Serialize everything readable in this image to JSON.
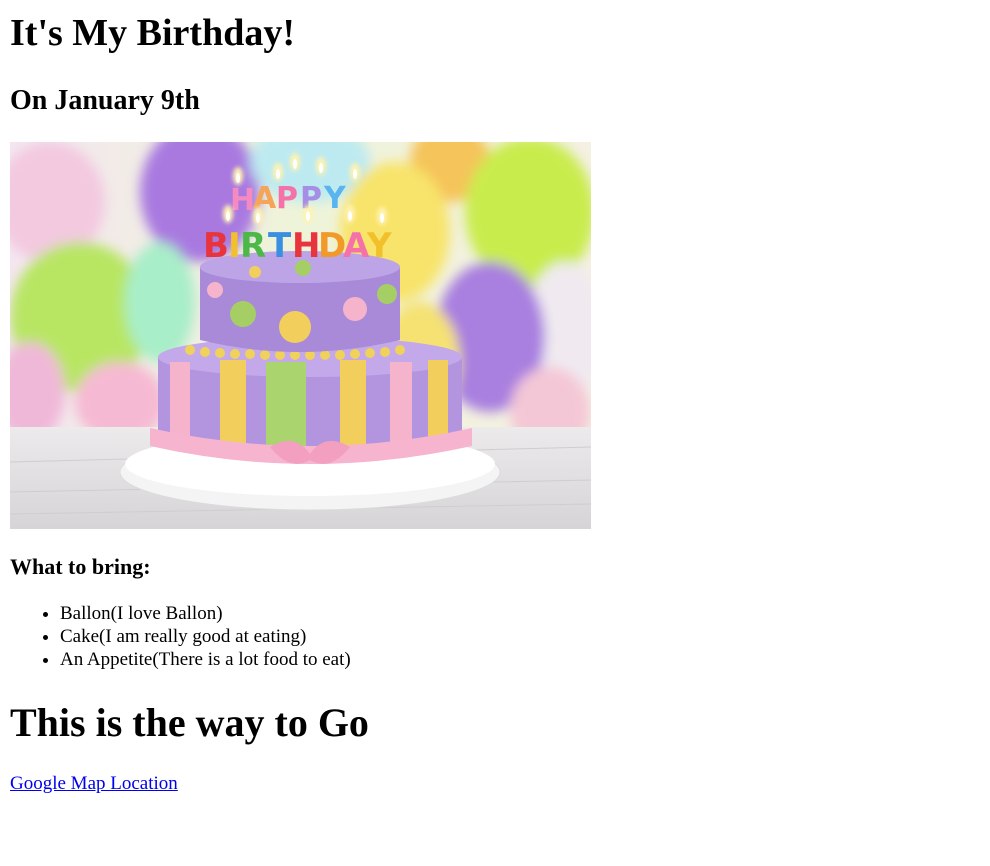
{
  "page": {
    "title": "It's My Birthday!",
    "subtitle": "On January 9th",
    "image": {
      "subject": "birthday-cake",
      "candle_text": "HAPPY BIRTHDAY"
    },
    "bring_heading": "What to bring:",
    "bring_items": [
      "Ballon(I love Ballon)",
      "Cake(I am really good at eating)",
      "An Appetite(There is a lot food to eat)"
    ],
    "directions_heading": "This is the way to Go",
    "map_link": "Google Map Location"
  },
  "colors": {
    "text": "#000000",
    "link": "#0000ee",
    "cake_purple": "#a98ad8",
    "cake_pink": "#f7b3cf",
    "cake_green": "#a7d36c",
    "cake_yellow": "#f2d05a"
  }
}
